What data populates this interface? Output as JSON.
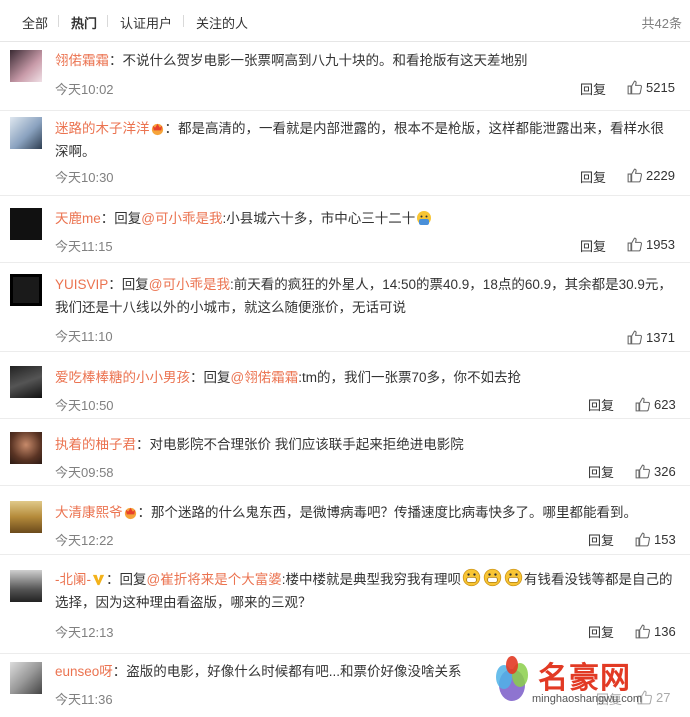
{
  "tabs": [
    {
      "label": "全部"
    },
    {
      "label": "热门"
    },
    {
      "label": "认证用户"
    },
    {
      "label": "关注的人"
    }
  ],
  "total": "共42条",
  "reply_label": "回复",
  "comments": [
    {
      "user": "翎偌霜霜",
      "sep": "：",
      "prefix": "",
      "mention": "",
      "text": "不说什么贺岁电影一张票啊高到八九十块的。和看抢版有这天差地别",
      "time": "今天10:02",
      "likes": "5215"
    },
    {
      "user": "迷路的木子洋洋",
      "sep": "：",
      "prefix": "",
      "mention": "",
      "text": "都是高清的，一看就是内部泄露的，根本不是枪版，这样都能泄露出来，看样水很深啊。",
      "time": "今天10:30",
      "likes": "2229"
    },
    {
      "user": "天鹿me",
      "sep": "：",
      "prefix": "回复",
      "mention": "@可小乖是我",
      "text": ":小县城六十多，市中心三十二十",
      "time": "今天11:15",
      "likes": "1953"
    },
    {
      "user": "YUISVIP",
      "sep": "：",
      "prefix": "回复",
      "mention": "@可小乖是我",
      "text": ":前天看的疯狂的外星人，14:50的票40.9，18点的60.9，其余都是30.9元，我们还是十八线以外的小城市，就这么随便涨价，无话可说",
      "time": "今天11:10",
      "likes": "1371"
    },
    {
      "user": "爱吃棒棒糖的小小男孩",
      "sep": "：",
      "prefix": "回复",
      "mention": "@翎偌霜霜",
      "text": ":tm的，我们一张票70多，你不如去抢",
      "time": "今天10:50",
      "likes": "623"
    },
    {
      "user": "执着的柚子君",
      "sep": "：",
      "prefix": "",
      "mention": "",
      "text": "对电影院不合理张价 我们应该联手起来拒绝进电影院",
      "time": "今天09:58",
      "likes": "326"
    },
    {
      "user": "大清康熙爷",
      "sep": "：",
      "prefix": "",
      "mention": "",
      "text": "那个迷路的什么鬼东西，是微博病毒吧？传播速度比病毒快多了。哪里都能看到。",
      "time": "今天12:22",
      "likes": "153"
    },
    {
      "user": "-北阑-",
      "sep": "：",
      "prefix": "回复",
      "mention": "@崔折将来是个大富婆",
      "text": ":楼中楼就是典型我穷我有理呗",
      "text2": "有钱看没钱等都是自己的选择，因为这种理由看盗版，哪来的三观？",
      "time": "今天12:13",
      "likes": "136"
    },
    {
      "user": "eunseo呀",
      "sep": "：",
      "prefix": "",
      "mention": "",
      "text": "盗版的电影，好像什么时候都有吧...和票价好像没啥关系",
      "time": "今天11:36",
      "likes": "27"
    }
  ],
  "watermark": {
    "name": "名豪网",
    "url": "minghaoshangwu.com"
  },
  "colors": {
    "accent": "#eb7350",
    "muted": "#808080",
    "watermark": "#e23a24"
  }
}
